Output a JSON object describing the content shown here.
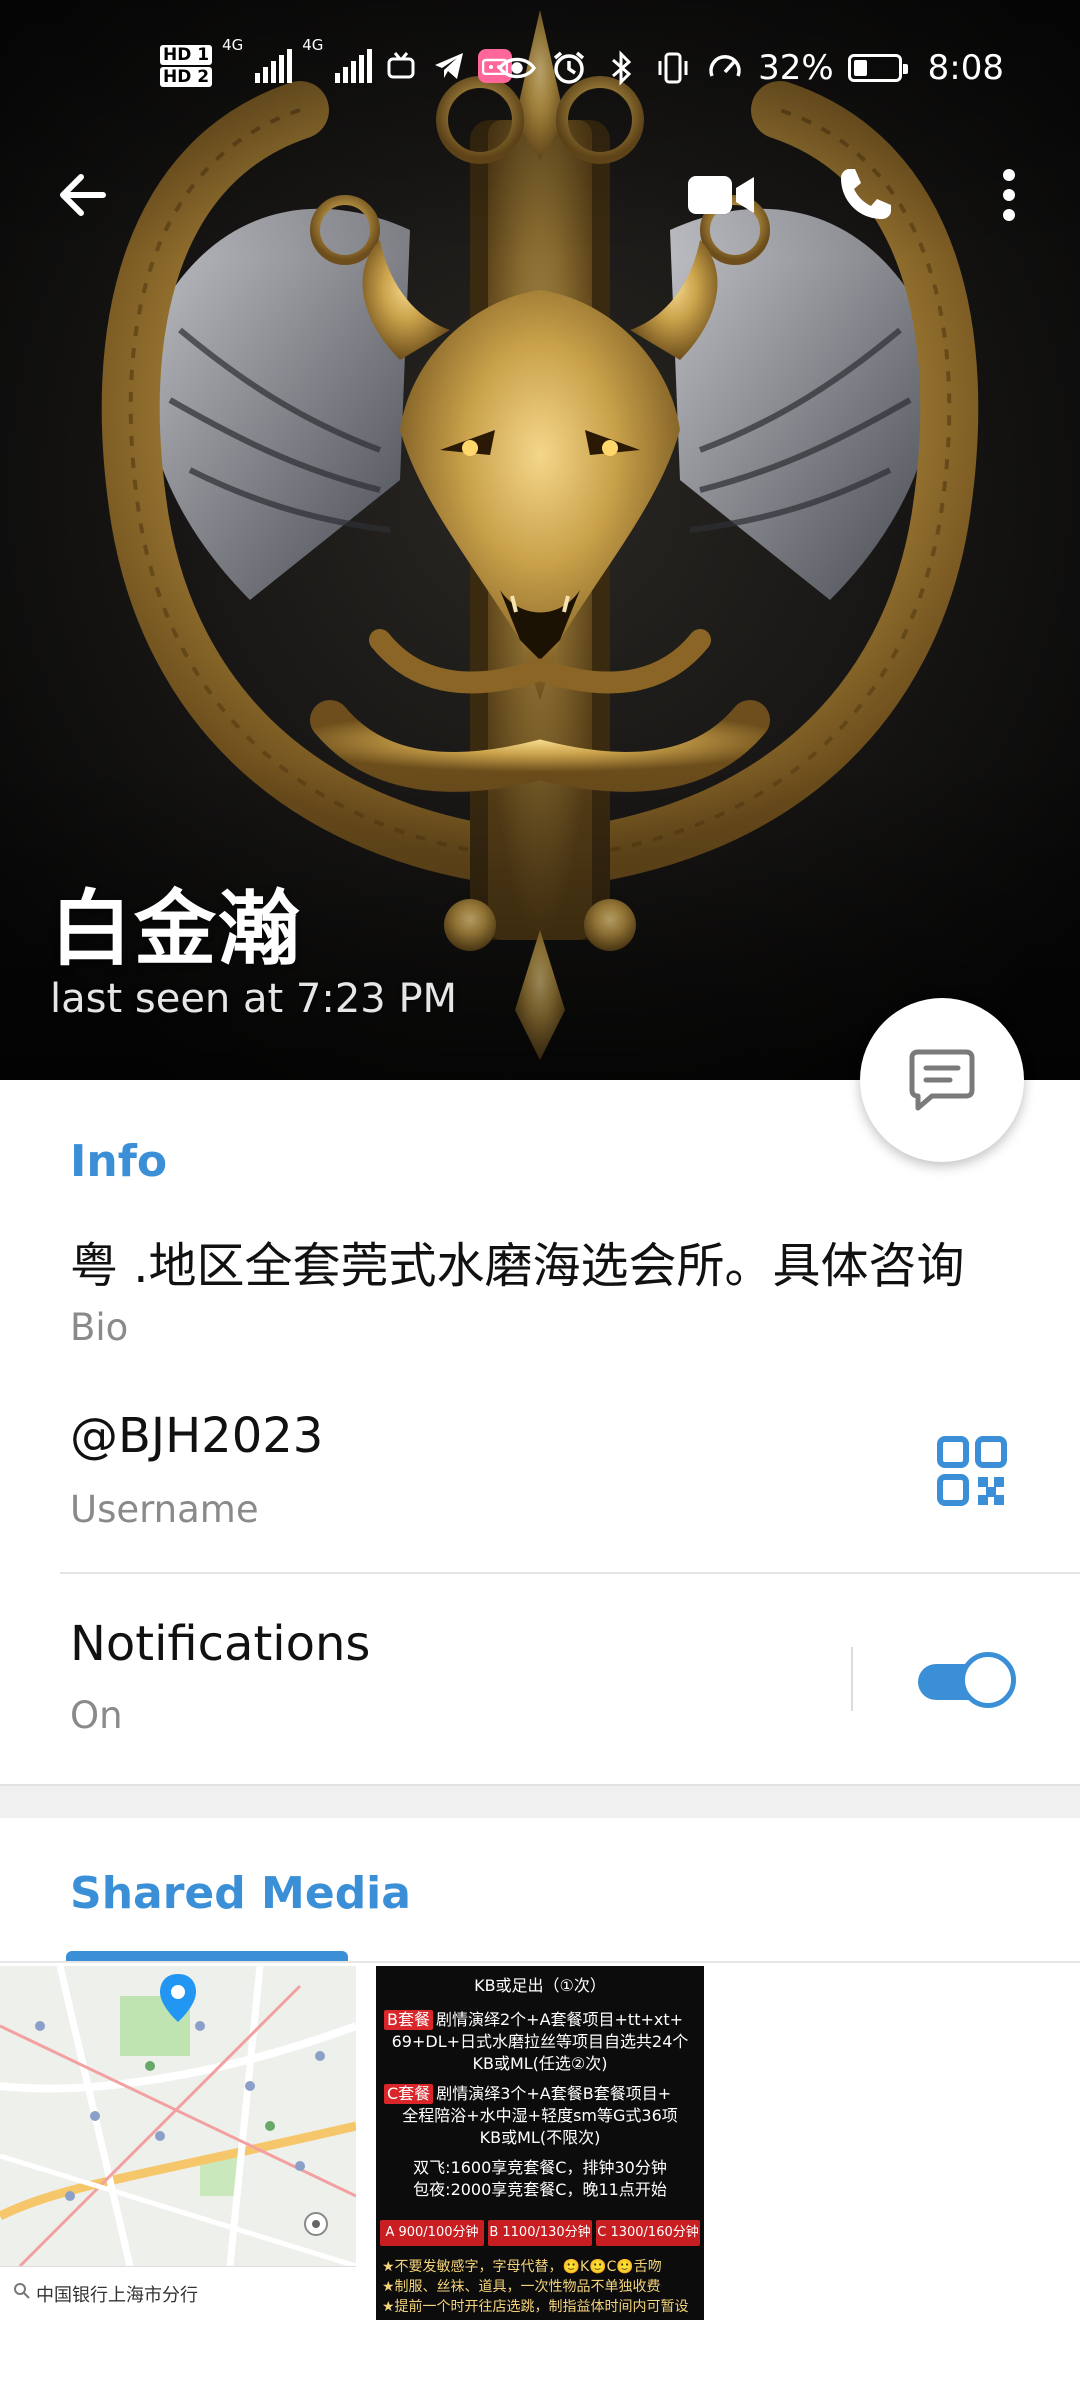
{
  "status_bar": {
    "hd1": "HD 1",
    "hd2": "HD 2",
    "net1": "4G",
    "net2": "4G",
    "app_badge": "bilibili",
    "battery_percent": 32,
    "battery_label": "32%",
    "time": "8:08"
  },
  "toolbar": {
    "back_icon": "arrow-left-icon",
    "video_icon": "video-camera-icon",
    "call_icon": "phone-icon",
    "more_icon": "more-vertical-icon"
  },
  "profile": {
    "name": "白金瀚",
    "last_seen": "last seen at 7:23 PM",
    "message_icon": "message-icon"
  },
  "info": {
    "title": "Info",
    "bio_value": "粤 .地区全套莞式水磨海选会所。具体咨询",
    "bio_label": "Bio",
    "username_value": "@BJH2023",
    "username_label": "Username",
    "qr_icon": "qr-code-icon",
    "notifications_title": "Notifications",
    "notifications_value": "On",
    "notifications_enabled": true
  },
  "shared_media": {
    "title": "Shared Media",
    "map_caption": "中国银行上海市分行",
    "promo": {
      "line1": "KB或足出（①次）",
      "b_tag": "B套餐",
      "b_line1": "剧情演绎2个+A套餐项目+tt+xt+",
      "b_line2": "69+DL+日式水磨拉丝等项目自选共24个",
      "b_line3": "KB或ML(任选②次)",
      "c_tag": "C套餐",
      "c_line1": "剧情演绎3个+A套餐B套餐项目+",
      "c_line2": "全程陪浴+水中湿+轻度sm等G式36项",
      "c_line3": "KB或ML(不限次)",
      "note1": "双飞:1600享竞套餐C，排钟30分钟",
      "note2": "包夜:2000享竞套餐C，晚11点开始",
      "price_a": "A 900/100分钟",
      "price_b": "B 1100/130分钟",
      "price_c": "C 1300/160分钟",
      "foot1": "★不要发敏感字，字母代替，🙂K🙂C🙂舌吻",
      "foot2": "★制服、丝袜、道具，一次性物品不单独收费",
      "foot3": "★提前一个时开往店选跳，制指益体时间内可暂设"
    }
  },
  "colors": {
    "accent": "#3a8fd6",
    "primary_text": "#111111",
    "secondary_text": "#8a8a8a",
    "hero_bg": "#0d0c0b",
    "gold": "#c9a14a"
  }
}
